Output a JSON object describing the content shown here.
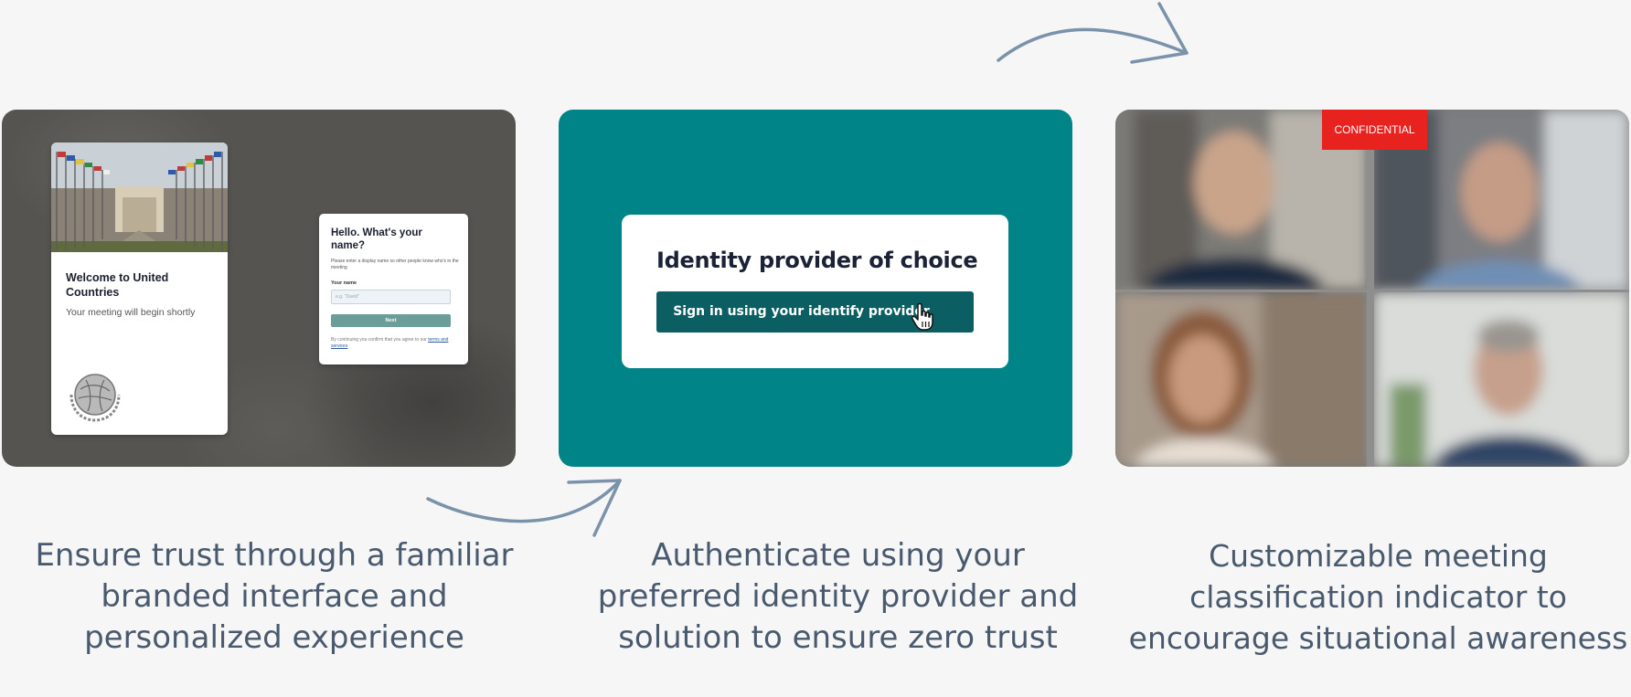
{
  "card1": {
    "welcome_title": "Welcome to United Countries",
    "welcome_subtitle": "Your meeting will begin shortly",
    "emblem_icon": "globe-laurel-emblem-icon",
    "name_form": {
      "title": "Hello. What's your name?",
      "description": "Please enter a display name so other people know who's in the meeting",
      "field_label": "Your name",
      "field_placeholder": "e.g. \"David\"",
      "next_label": "Next",
      "terms_prefix": "By continuing you confirm that you agree to our",
      "terms_link": "terms and services"
    }
  },
  "card2": {
    "title": "Identity provider of choice",
    "button_label": "Sign in using your identify provider",
    "cursor_icon": "hand-pointer-icon",
    "bg_color": "#008488",
    "button_color": "#0b5e61"
  },
  "card3": {
    "badge": "CONFIDENTIAL",
    "badge_color": "#e8221f"
  },
  "captions": {
    "first": "Ensure trust through a familiar branded interface and personalized experience",
    "second": "Authenticate using your preferred identity provider and solution to ensure zero trust",
    "third": "Customizable meeting classification indicator to encourage situational awareness"
  },
  "arrows": {
    "color": "#7b93aa"
  }
}
